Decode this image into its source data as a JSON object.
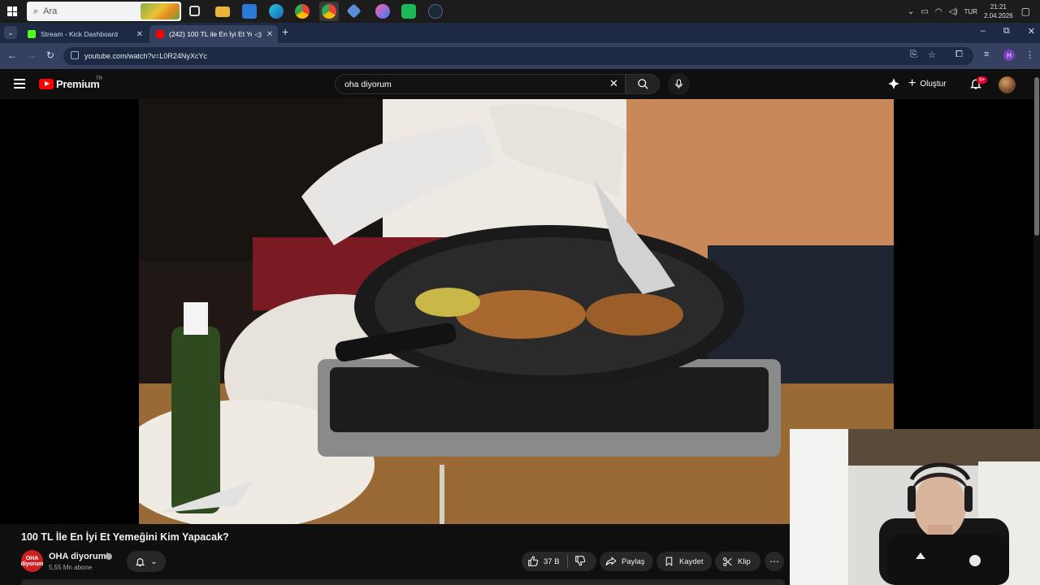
{
  "taskbar": {
    "search_placeholder": "Ara",
    "language": "TUR",
    "time": "21:21",
    "date": "2.04.2026"
  },
  "browser": {
    "tabs": [
      {
        "label": "Stream - Kick Dashboard",
        "active": false
      },
      {
        "label": "(242) 100 TL ile En İyi Et Yem",
        "active": true
      }
    ],
    "url": "youtube.com/watch?v=L0R24NyXcYc",
    "profile_initial": "H"
  },
  "youtube": {
    "logo_text": "Premium",
    "country_code": "TR",
    "search_value": "oha diyorum",
    "create_label": "Oluştur",
    "notification_count": "9+"
  },
  "video": {
    "title": "100 TL İle En İyi Et Yemeğini Kim Yapacak?",
    "channel_name": "OHA diyorumI",
    "channel_avatar_text": "OHA diyorum",
    "subscribers": "5,55 Mn abone",
    "likes": "37 B",
    "share_label": "Paylaş",
    "save_label": "Kaydet",
    "clip_label": "Klip",
    "more_label": "⋯"
  },
  "colors": {
    "youtube_red": "#ff0000",
    "chrome_frame": "#1e2a44",
    "chrome_toolbar": "#35415e",
    "yt_background": "#0f0f0f",
    "pill_background": "#272727"
  }
}
